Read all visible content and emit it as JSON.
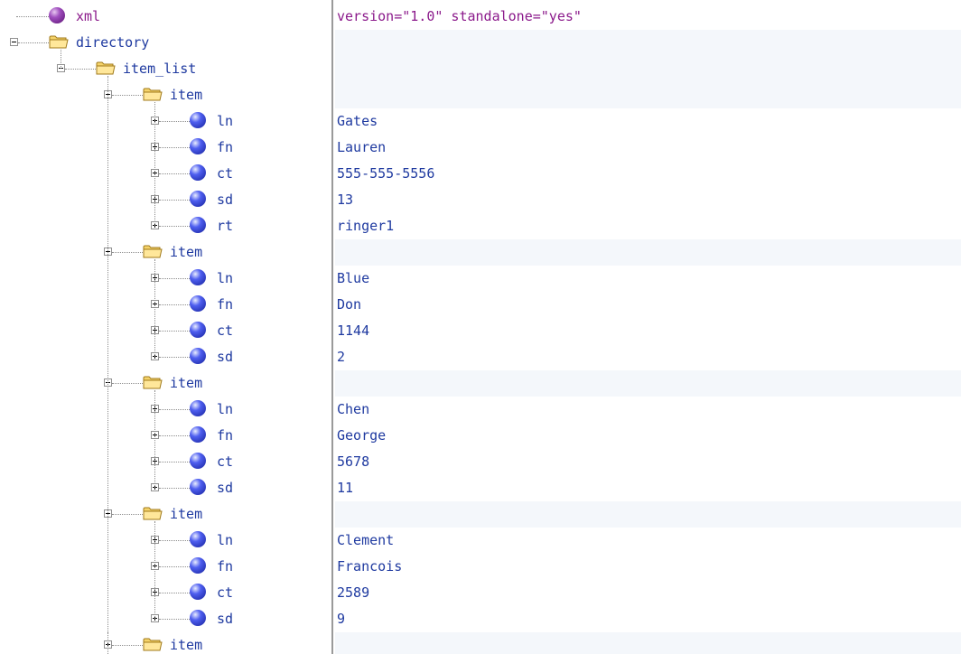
{
  "tree": {
    "nodes": [
      {
        "label": "xml",
        "depth": 0,
        "kind": "pi",
        "toggle": "none",
        "value": "version=\"1.0\" standalone=\"yes\""
      },
      {
        "label": "directory",
        "depth": 0,
        "kind": "element",
        "toggle": "expanded",
        "value": ""
      },
      {
        "label": "item_list",
        "depth": 1,
        "kind": "element",
        "toggle": "expanded",
        "value": ""
      },
      {
        "label": "item",
        "depth": 2,
        "kind": "element",
        "toggle": "expanded",
        "value": ""
      },
      {
        "label": "ln",
        "depth": 3,
        "kind": "leaf",
        "toggle": "collapsed",
        "value": "Gates"
      },
      {
        "label": "fn",
        "depth": 3,
        "kind": "leaf",
        "toggle": "collapsed",
        "value": "Lauren"
      },
      {
        "label": "ct",
        "depth": 3,
        "kind": "leaf",
        "toggle": "collapsed",
        "value": "555-555-5556"
      },
      {
        "label": "sd",
        "depth": 3,
        "kind": "leaf",
        "toggle": "collapsed",
        "value": "13"
      },
      {
        "label": "rt",
        "depth": 3,
        "kind": "leaf",
        "toggle": "collapsed",
        "value": "ringer1"
      },
      {
        "label": "item",
        "depth": 2,
        "kind": "element",
        "toggle": "expanded",
        "value": ""
      },
      {
        "label": "ln",
        "depth": 3,
        "kind": "leaf",
        "toggle": "collapsed",
        "value": "Blue"
      },
      {
        "label": "fn",
        "depth": 3,
        "kind": "leaf",
        "toggle": "collapsed",
        "value": "Don"
      },
      {
        "label": "ct",
        "depth": 3,
        "kind": "leaf",
        "toggle": "collapsed",
        "value": "1144"
      },
      {
        "label": "sd",
        "depth": 3,
        "kind": "leaf",
        "toggle": "collapsed",
        "value": "2"
      },
      {
        "label": "item",
        "depth": 2,
        "kind": "element",
        "toggle": "expanded",
        "value": ""
      },
      {
        "label": "ln",
        "depth": 3,
        "kind": "leaf",
        "toggle": "collapsed",
        "value": "Chen"
      },
      {
        "label": "fn",
        "depth": 3,
        "kind": "leaf",
        "toggle": "collapsed",
        "value": "George"
      },
      {
        "label": "ct",
        "depth": 3,
        "kind": "leaf",
        "toggle": "collapsed",
        "value": "5678"
      },
      {
        "label": "sd",
        "depth": 3,
        "kind": "leaf",
        "toggle": "collapsed",
        "value": "11"
      },
      {
        "label": "item",
        "depth": 2,
        "kind": "element",
        "toggle": "expanded",
        "value": ""
      },
      {
        "label": "ln",
        "depth": 3,
        "kind": "leaf",
        "toggle": "collapsed",
        "value": "Clement"
      },
      {
        "label": "fn",
        "depth": 3,
        "kind": "leaf",
        "toggle": "collapsed",
        "value": "Francois"
      },
      {
        "label": "ct",
        "depth": 3,
        "kind": "leaf",
        "toggle": "collapsed",
        "value": "2589"
      },
      {
        "label": "sd",
        "depth": 3,
        "kind": "leaf",
        "toggle": "collapsed",
        "value": "9"
      },
      {
        "label": "item",
        "depth": 2,
        "kind": "element",
        "toggle": "collapsed",
        "value": ""
      }
    ]
  },
  "icons": {
    "pi": "purple-ball-icon",
    "element": "folder-icon",
    "leaf": "blue-ball-icon"
  },
  "colors": {
    "node_text": "#1f3aa0",
    "declaration_text": "#8b1a8b",
    "value_text": "#1f3aa0",
    "band": "#f4f7fb",
    "splitter": "#9a9a9a"
  }
}
